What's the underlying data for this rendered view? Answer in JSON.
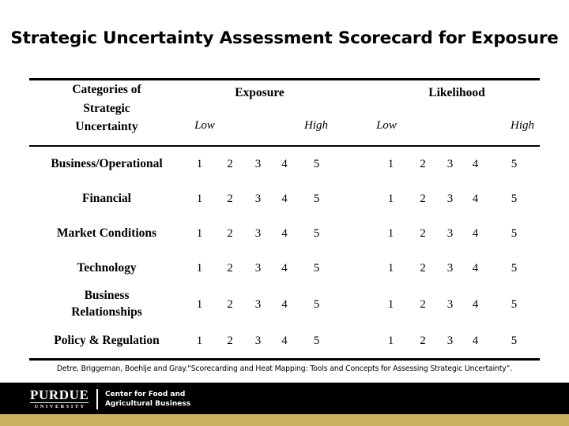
{
  "slide": {
    "title": "Strategic Uncertainty Assessment Scorecard for Exposure",
    "citation": "Detre, Briggeman, Boehlje and Gray.“Scorecarding and Heat Mapping: Tools and Concepts for Assessing Strategic Uncertainty”.",
    "colors": {
      "background": "#ffffff",
      "text": "#000000",
      "footer_bar": "#000000",
      "accent_gold": "#cbb162"
    }
  },
  "table": {
    "category_header": {
      "line1": "Categories of",
      "line2": "Strategic",
      "line3": "Uncertainty"
    },
    "groups": [
      {
        "label": "Exposure",
        "low_label": "Low",
        "high_label": "High"
      },
      {
        "label": "Likelihood",
        "low_label": "Low",
        "high_label": "High"
      }
    ],
    "scale": [
      "1",
      "2",
      "3",
      "4",
      "5"
    ],
    "rows": [
      {
        "label": "Business/Operational",
        "label_line1": "Business/Operational",
        "label_line2": "",
        "exposure": [
          "1",
          "2",
          "3",
          "4",
          "5"
        ],
        "likelihood": [
          "1",
          "2",
          "3",
          "4",
          "5"
        ]
      },
      {
        "label": "Financial",
        "label_line1": "Financial",
        "label_line2": "",
        "exposure": [
          "1",
          "2",
          "3",
          "4",
          "5"
        ],
        "likelihood": [
          "1",
          "2",
          "3",
          "4",
          "5"
        ]
      },
      {
        "label": "Market Conditions",
        "label_line1": "Market Conditions",
        "label_line2": "",
        "exposure": [
          "1",
          "2",
          "3",
          "4",
          "5"
        ],
        "likelihood": [
          "1",
          "2",
          "3",
          "4",
          "5"
        ]
      },
      {
        "label": "Technology",
        "label_line1": "Technology",
        "label_line2": "",
        "exposure": [
          "1",
          "2",
          "3",
          "4",
          "5"
        ],
        "likelihood": [
          "1",
          "2",
          "3",
          "4",
          "5"
        ]
      },
      {
        "label": "Business Relationships",
        "label_line1": "Business",
        "label_line2": "Relationships",
        "exposure": [
          "1",
          "2",
          "3",
          "4",
          "5"
        ],
        "likelihood": [
          "1",
          "2",
          "3",
          "4",
          "5"
        ]
      },
      {
        "label": "Policy & Regulation",
        "label_line1": "Policy & Regulation",
        "label_line2": "",
        "exposure": [
          "1",
          "2",
          "3",
          "4",
          "5"
        ],
        "likelihood": [
          "1",
          "2",
          "3",
          "4",
          "5"
        ]
      }
    ]
  },
  "footer": {
    "logo": {
      "wordmark": "PURDUE",
      "university": "UNIVERSITY",
      "center_line1": "Center for Food and",
      "center_line2": "Agricultural Business"
    }
  }
}
